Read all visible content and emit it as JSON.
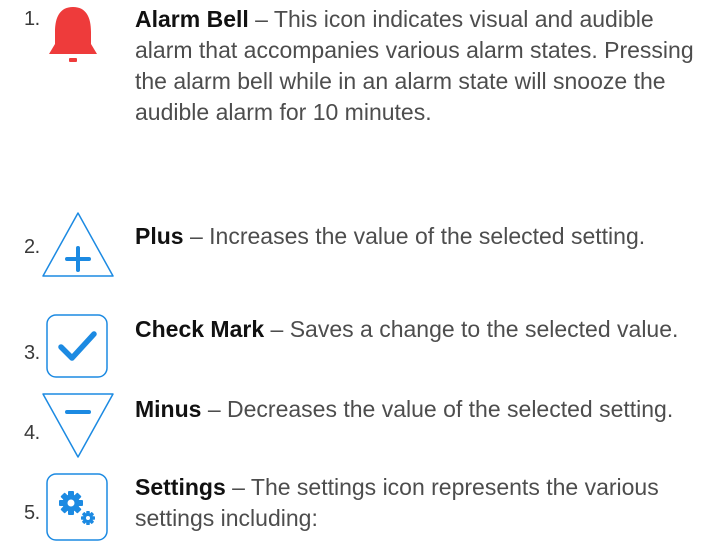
{
  "colors": {
    "alarm_red": "#ee3b3b",
    "icon_blue": "#1c8ae2",
    "text_gray": "#4d4d4d",
    "title_black": "#111111"
  },
  "items": [
    {
      "number": "1.",
      "icon": "alarm-bell-icon",
      "title": "Alarm Bell",
      "description": " – This icon indicates visual and audible alarm that accompanies various alarm states. Pressing the alarm bell while in an alarm state will snooze the audible alarm for 10 minutes."
    },
    {
      "number": "2.",
      "icon": "plus-icon",
      "title": "Plus",
      "description": " – Increases the value of the selected setting."
    },
    {
      "number": "3.",
      "icon": "check-mark-icon",
      "title": "Check Mark",
      "description": " – Saves a change to the selected value."
    },
    {
      "number": "4.",
      "icon": "minus-icon",
      "title": "Minus",
      "description": " – Decreases the value of the selected setting."
    },
    {
      "number": "5.",
      "icon": "settings-gear-icon",
      "title": "Settings",
      "description": " – The settings icon represents the various settings including:"
    }
  ]
}
